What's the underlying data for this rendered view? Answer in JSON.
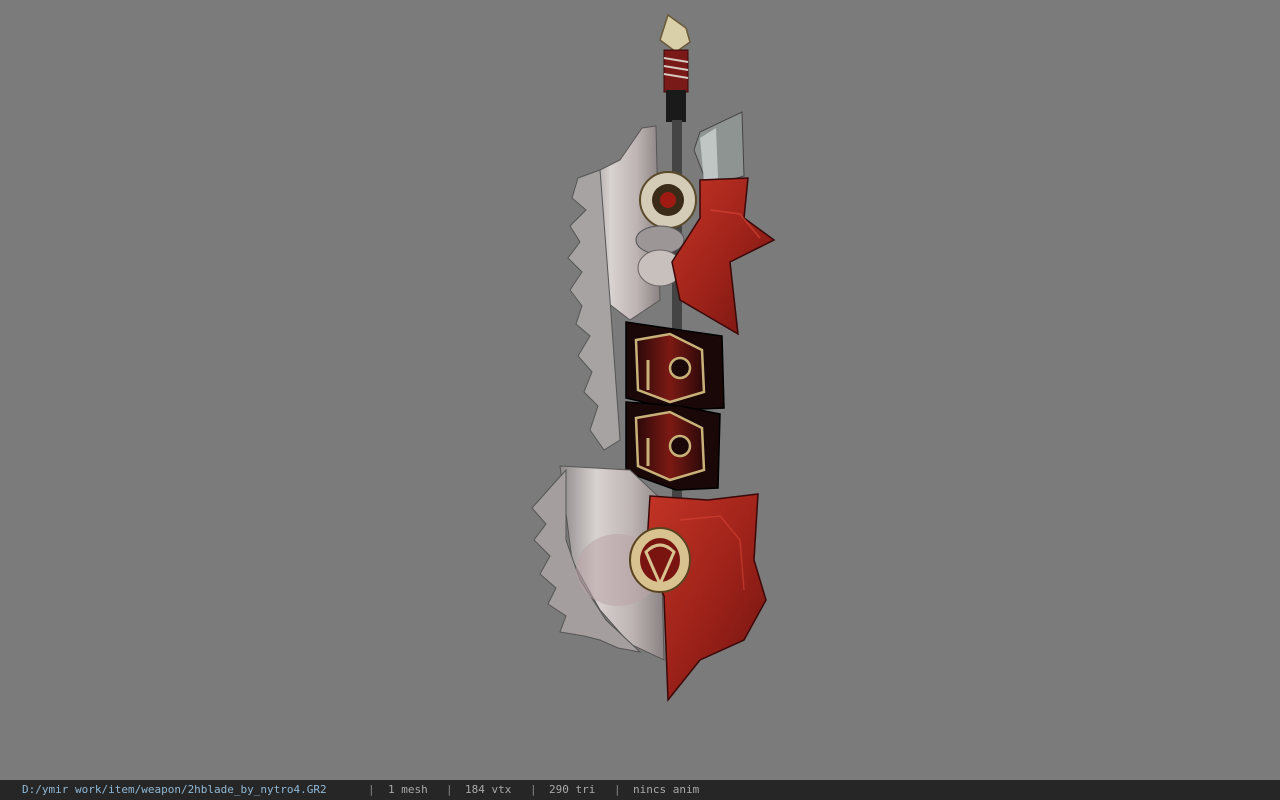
{
  "viewer": {
    "background_color": "#7b7b7b",
    "model_icon": "two-handed-sword-model"
  },
  "status": {
    "file_path": "D:/ymir work/item/weapon/2hblade_by_nytro4.GR2",
    "separator": "|",
    "mesh_count": "1 mesh",
    "vertex_count": "184 vtx",
    "triangle_count": "290 tri",
    "anim_info": "nincs anim"
  },
  "colors": {
    "statusbar_bg": "#262626",
    "path_text": "#8fb8d6",
    "info_text": "#a9a9a9",
    "blade_steel": "#cfc8c6",
    "armor_red": "#b0261c"
  }
}
